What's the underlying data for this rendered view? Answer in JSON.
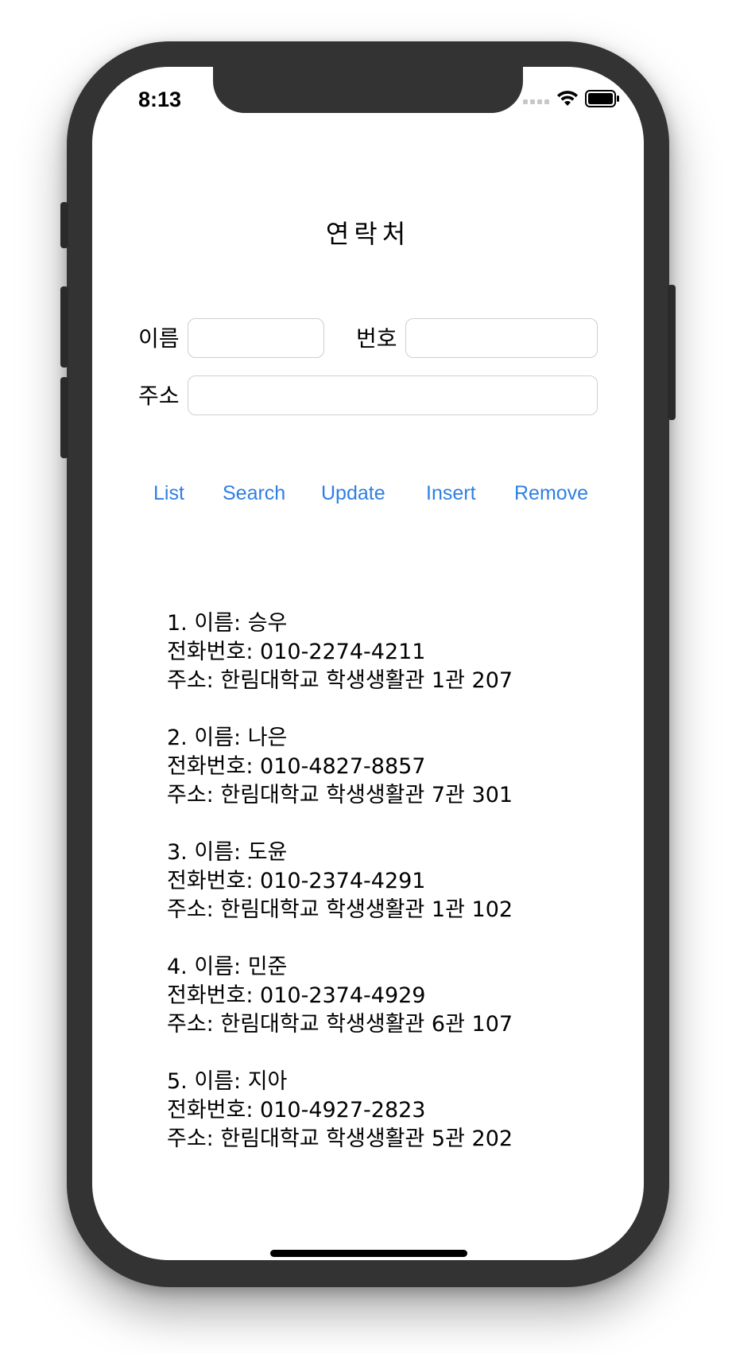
{
  "status_bar": {
    "time": "8:13",
    "icons": [
      "cellular-signal-icon",
      "wifi-icon",
      "battery-icon"
    ]
  },
  "title": "연락처",
  "form": {
    "name_label": "이름",
    "name_value": "",
    "number_label": "번호",
    "number_value": "",
    "address_label": "주소",
    "address_value": ""
  },
  "buttons": {
    "list": "List",
    "search": "Search",
    "update": "Update",
    "insert": "Insert",
    "remove": "Remove"
  },
  "contacts": [
    {
      "name_line": "1. 이름: 승우",
      "phone_line": "전화번호: 010-2274-4211",
      "address_line": "주소: 한림대학교 학생생활관 1관 207"
    },
    {
      "name_line": "2. 이름: 나은",
      "phone_line": "전화번호: 010-4827-8857",
      "address_line": "주소: 한림대학교 학생생활관 7관 301"
    },
    {
      "name_line": "3. 이름: 도윤",
      "phone_line": "전화번호: 010-2374-4291",
      "address_line": "주소: 한림대학교 학생생활관 1관 102"
    },
    {
      "name_line": "4. 이름: 민준",
      "phone_line": "전화번호: 010-2374-4929",
      "address_line": "주소: 한림대학교 학생생활관 6관 107"
    },
    {
      "name_line": "5. 이름: 지아",
      "phone_line": "전화번호: 010-4927-2823",
      "address_line": "주소: 한림대학교 학생생활관 5관 202"
    }
  ],
  "colors": {
    "accent": "#2f7fe3",
    "frame": "#333333",
    "text": "#000000",
    "field_border": "#cfcfcf"
  }
}
